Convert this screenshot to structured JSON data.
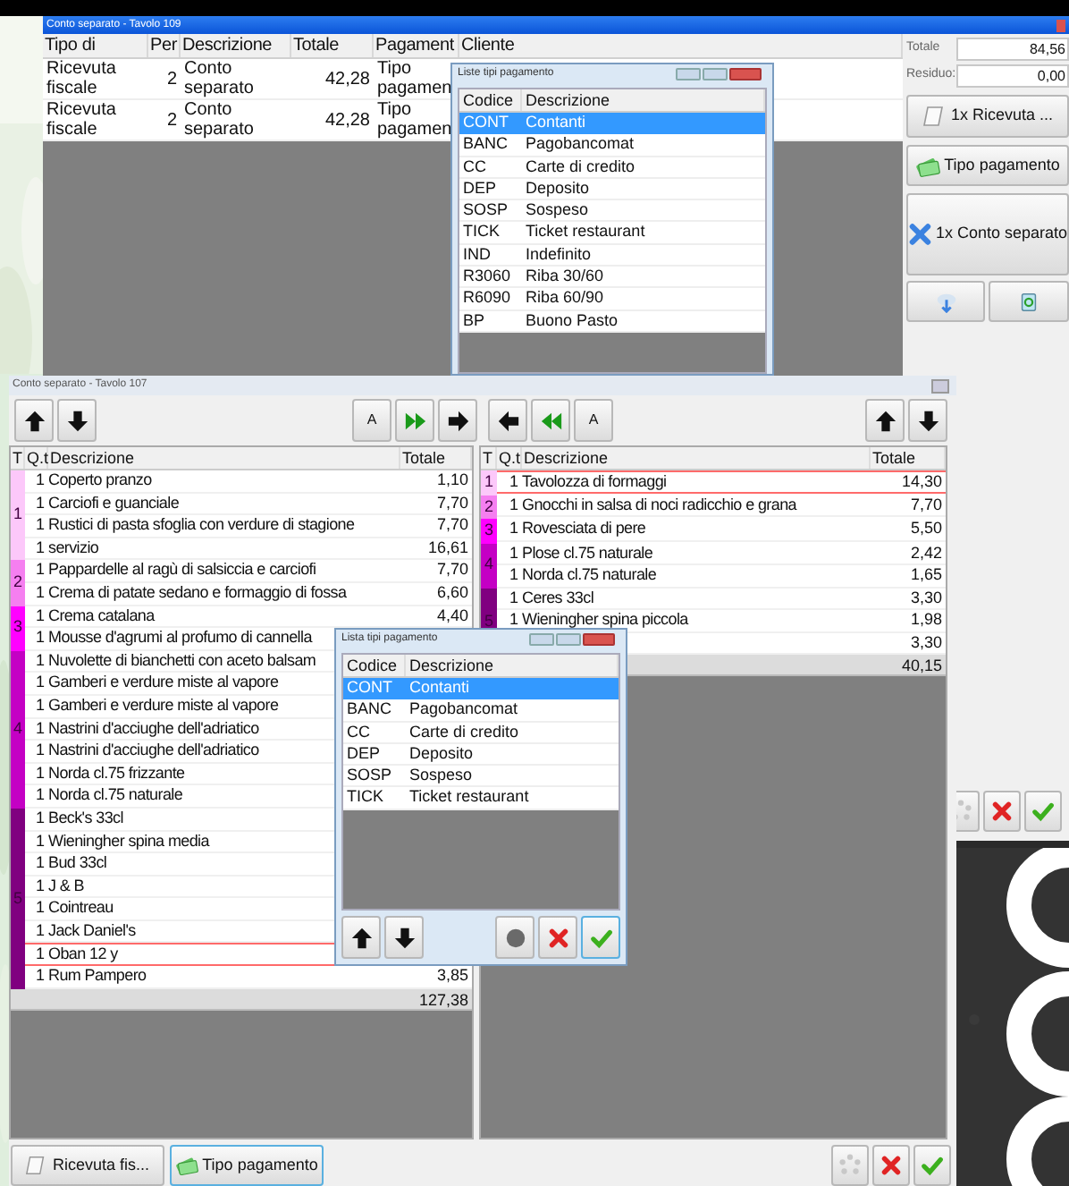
{
  "window_1": {
    "title": "Conto separato - Tavolo 109",
    "columns": [
      "Tipo di",
      "Per",
      "Descrizione",
      "Totale",
      "Pagament",
      "Cliente"
    ],
    "rows": [
      {
        "type": "Ricevuta fiscale",
        "per": "2",
        "description": "Conto separato",
        "total": "42,28",
        "payment": "Tipo pagamen"
      },
      {
        "type": "Ricevuta fiscale",
        "per": "2",
        "description": "Conto separato",
        "total": "42,28",
        "payment": "Tipo pagamen"
      }
    ],
    "totals": [
      {
        "label": "Totale",
        "value": "84,56"
      },
      {
        "label": "Residuo:",
        "value": "0,00"
      }
    ],
    "buttons": [
      "1x Ricevuta ...",
      "Tipo pagamento",
      "1x Conto separato"
    ],
    "popup": {
      "title": "Liste tipi pagamento",
      "columns": [
        "Codice",
        "Descrizione"
      ],
      "rows": [
        {
          "code": "CONT",
          "description": "Contanti",
          "selected": true
        },
        {
          "code": "BANC",
          "description": "Pagobancomat",
          "selected": false
        },
        {
          "code": "CC",
          "description": "Carte di credito",
          "selected": false
        },
        {
          "code": "DEP",
          "description": "Deposito",
          "selected": false
        },
        {
          "code": "SOSP",
          "description": "Sospeso",
          "selected": false
        },
        {
          "code": "TICK",
          "description": "Ticket restaurant",
          "selected": false
        },
        {
          "code": "IND",
          "description": "Indefinito",
          "selected": false
        },
        {
          "code": "R3060",
          "description": "Riba 30/60",
          "selected": false
        },
        {
          "code": "R6090",
          "description": "Riba 60/90",
          "selected": false
        },
        {
          "code": "BP",
          "description": "Buono Pasto",
          "selected": false
        }
      ]
    }
  },
  "window_2": {
    "title": "Conto separato - Tavolo 107",
    "toolbar_letters": [
      "A",
      "A"
    ],
    "left_table": {
      "columns": [
        "T",
        "Q.t",
        "Descrizione",
        "Totale"
      ],
      "groups": [
        {
          "label": "1",
          "color": "#fcc8fa",
          "items": [
            {
              "qty": "1",
              "description": "Coperto pranzo",
              "total": "1,10",
              "selected": false
            },
            {
              "qty": "1",
              "description": "Carciofi e guanciale",
              "total": "7,70",
              "selected": false
            },
            {
              "qty": "1",
              "description": "Rustici di pasta sfoglia con verdure di stagione",
              "total": "7,70",
              "selected": false
            },
            {
              "qty": "1",
              "description": "servizio",
              "total": "16,61",
              "selected": false
            }
          ]
        },
        {
          "label": "2",
          "color": "#f57ff0",
          "items": [
            {
              "qty": "1",
              "description": "Pappardelle al ragù di salsiccia e carciofi",
              "total": "7,70",
              "selected": false
            },
            {
              "qty": "1",
              "description": "Crema di patate sedano e formaggio di fossa",
              "total": "6,60",
              "selected": false
            }
          ]
        },
        {
          "label": "3",
          "color": "#ff00ff",
          "items": [
            {
              "qty": "1",
              "description": "Crema catalana",
              "total": "4,40",
              "selected": false
            },
            {
              "qty": "1",
              "description": "Mousse d'agrumi al profumo di cannella",
              "selected": false
            }
          ]
        },
        {
          "label": "4",
          "color": "#c400c4",
          "items": [
            {
              "qty": "1",
              "description": "Nuvolette di bianchetti con aceto balsam",
              "selected": false
            },
            {
              "qty": "1",
              "description": "Gamberi e verdure miste al vapore",
              "selected": false
            },
            {
              "qty": "1",
              "description": "Gamberi e verdure miste al vapore",
              "selected": false
            },
            {
              "qty": "1",
              "description": "Nastrini d'acciughe dell'adriatico",
              "selected": false
            },
            {
              "qty": "1",
              "description": "Nastrini d'acciughe dell'adriatico",
              "selected": false
            },
            {
              "qty": "1",
              "description": "Norda cl.75 frizzante",
              "selected": false
            },
            {
              "qty": "1",
              "description": "Norda cl.75 naturale",
              "selected": false
            }
          ]
        },
        {
          "label": "5",
          "color": "#800080",
          "items": [
            {
              "qty": "1",
              "description": "Beck's 33cl",
              "selected": false
            },
            {
              "qty": "1",
              "description": "Wieningher spina media",
              "selected": false
            },
            {
              "qty": "1",
              "description": "Bud 33cl",
              "selected": false
            },
            {
              "qty": "1",
              "description": "J & B",
              "selected": false
            },
            {
              "qty": "1",
              "description": "Cointreau",
              "selected": false
            },
            {
              "qty": "1",
              "description": "Jack Daniel's",
              "selected": false
            },
            {
              "qty": "1",
              "description": "Oban 12 y",
              "selected": true
            },
            {
              "qty": "1",
              "description": "Rum Pampero",
              "total": "3,85",
              "selected": false
            }
          ]
        }
      ],
      "grand_total": "127,38"
    },
    "right_table": {
      "columns": [
        "T",
        "Q.t",
        "Descrizione",
        "Totale"
      ],
      "groups": [
        {
          "label": "1",
          "color": "#fcc8fa",
          "items": [
            {
              "qty": "1",
              "description": "Tavolozza di formaggi",
              "total": "14,30",
              "selected": true
            }
          ]
        },
        {
          "label": "2",
          "color": "#f57ff0",
          "items": [
            {
              "qty": "1",
              "description": "Gnocchi in salsa di noci radicchio e grana",
              "total": "7,70",
              "selected": false
            }
          ]
        },
        {
          "label": "3",
          "color": "#ff00ff",
          "items": [
            {
              "qty": "1",
              "description": "Rovesciata di pere",
              "total": "5,50",
              "selected": false
            }
          ]
        },
        {
          "label": "4",
          "color": "#c400c4",
          "items": [
            {
              "qty": "1",
              "description": "Plose cl.75 naturale",
              "total": "2,42",
              "selected": false
            },
            {
              "qty": "1",
              "description": "Norda cl.75 naturale",
              "total": "1,65",
              "selected": false
            }
          ]
        },
        {
          "label": "5",
          "color": "#800080",
          "items": [
            {
              "qty": "1",
              "description": "Ceres 33cl",
              "total": "3,30",
              "selected": false
            },
            {
              "qty": "1",
              "description": "Wieningher spina piccola",
              "total": "1,98",
              "selected": false
            },
            {
              "total": "3,30",
              "selected": false
            }
          ]
        }
      ],
      "grand_total": "40,15"
    },
    "popup": {
      "title": "Lista tipi pagamento",
      "columns": [
        "Codice",
        "Descrizione"
      ],
      "rows": [
        {
          "code": "CONT",
          "description": "Contanti",
          "selected": true
        },
        {
          "code": "BANC",
          "description": "Pagobancomat",
          "selected": false
        },
        {
          "code": "CC",
          "description": "Carte di credito",
          "selected": false
        },
        {
          "code": "DEP",
          "description": "Deposito",
          "selected": false
        },
        {
          "code": "SOSP",
          "description": "Sospeso",
          "selected": false
        },
        {
          "code": "TICK",
          "description": "Ticket restaurant",
          "selected": false
        }
      ]
    },
    "footer_buttons": [
      {
        "label": "Ricevuta fis...",
        "selected": false
      },
      {
        "label": "Tipo pagamento",
        "selected": true
      }
    ]
  }
}
